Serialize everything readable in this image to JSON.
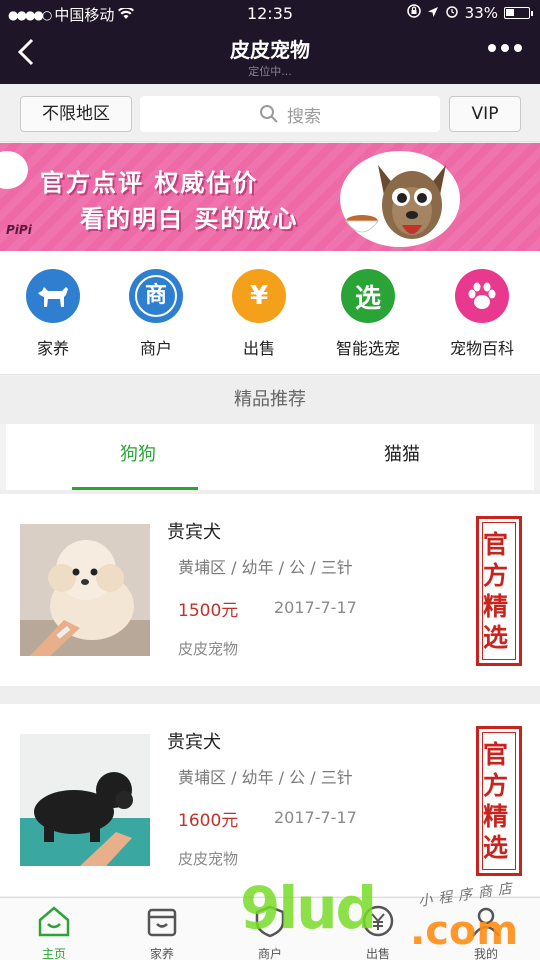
{
  "status_bar": {
    "carrier": "中国移动",
    "time": "12:35",
    "battery": "33%"
  },
  "nav": {
    "title": "皮皮宠物",
    "subtitle": "定位中..."
  },
  "filter": {
    "region_label": "不限地区",
    "search_placeholder": "搜索",
    "vip_label": "VIP"
  },
  "banner": {
    "line1": "官方点评 权威估价",
    "line2": "看的明白 买的放心",
    "logo": "PiPi"
  },
  "categories": [
    {
      "label": "家养",
      "icon": "dog-icon",
      "color": "#2f7fd0"
    },
    {
      "label": "商户",
      "icon": "shop-icon",
      "color": "#2f7fd0",
      "glyph": "商"
    },
    {
      "label": "出售",
      "icon": "yen-icon",
      "color": "#f5a01a",
      "glyph": "¥"
    },
    {
      "label": "智能选宠",
      "icon": "select-icon",
      "color": "#2aa436",
      "glyph": "选"
    },
    {
      "label": "宠物百科",
      "icon": "paw-icon",
      "color": "#e8398f"
    }
  ],
  "section": {
    "title": "精品推荐"
  },
  "tabs": [
    {
      "label": "狗狗",
      "active": true
    },
    {
      "label": "猫猫",
      "active": false
    }
  ],
  "listings": [
    {
      "name": "贵宾犬",
      "meta": "黄埔区 / 幼年 / 公 / 三针",
      "price": "1500元",
      "date": "2017-7-17",
      "shop": "皮皮宠物",
      "stamp": "官方精选"
    },
    {
      "name": "贵宾犬",
      "meta": "黄埔区 / 幼年 / 公 / 三针",
      "price": "1600元",
      "date": "2017-7-17",
      "shop": "皮皮宠物",
      "stamp": "官方精选"
    }
  ],
  "bottom_nav": [
    {
      "label": "主页",
      "icon": "home-icon",
      "active": true
    },
    {
      "label": "家养",
      "icon": "store-icon",
      "active": false
    },
    {
      "label": "商户",
      "icon": "shield-icon",
      "active": false
    },
    {
      "label": "出售",
      "icon": "yen-circle-icon",
      "active": false
    },
    {
      "label": "我的",
      "icon": "user-icon",
      "active": false
    }
  ],
  "watermark": {
    "brand": "9lud",
    "domain": ".com",
    "tagline": "小程序商店"
  },
  "colors": {
    "accent_green": "#2aa436",
    "price_red": "#c0322a",
    "nav_bg": "#1f1528",
    "banner_pink": "#ee6aa7"
  }
}
